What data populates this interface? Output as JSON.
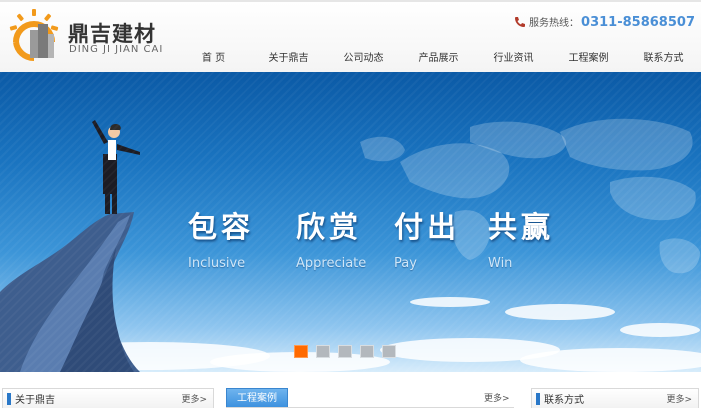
{
  "brand": {
    "name_cn": "鼎吉建材",
    "name_en": "DING JI JIAN CAI",
    "logo_icon": "sun-building-logo"
  },
  "header": {
    "hotline_label": "服务热线：",
    "hotline_number": "0311-85868507",
    "phone_icon": "phone-icon"
  },
  "nav": {
    "items": [
      {
        "label": "首 页"
      },
      {
        "label": "关于鼎吉"
      },
      {
        "label": "公司动态"
      },
      {
        "label": "产品展示"
      },
      {
        "label": "行业资讯"
      },
      {
        "label": "工程案例"
      },
      {
        "label": "联系方式"
      }
    ]
  },
  "banner": {
    "slogans": [
      {
        "cn": "包容",
        "en": "Inclusive"
      },
      {
        "cn": "欣赏",
        "en": "Appreciate"
      },
      {
        "cn": "付出",
        "en": "Pay"
      },
      {
        "cn": "共赢",
        "en": "Win"
      }
    ],
    "slide_count": 5,
    "active_slide": 1
  },
  "sections": {
    "about": {
      "title": "关于鼎吉",
      "more": "更多>"
    },
    "cases": {
      "title": "工程案例",
      "more": "更多>"
    },
    "contact": {
      "title": "联系方式",
      "more": "更多>"
    }
  },
  "colors": {
    "accent": "#2a78c8",
    "logo_orange": "#f29a1b",
    "hotline_blue": "#4a8fd6",
    "active_dot": "#ff6a00"
  }
}
